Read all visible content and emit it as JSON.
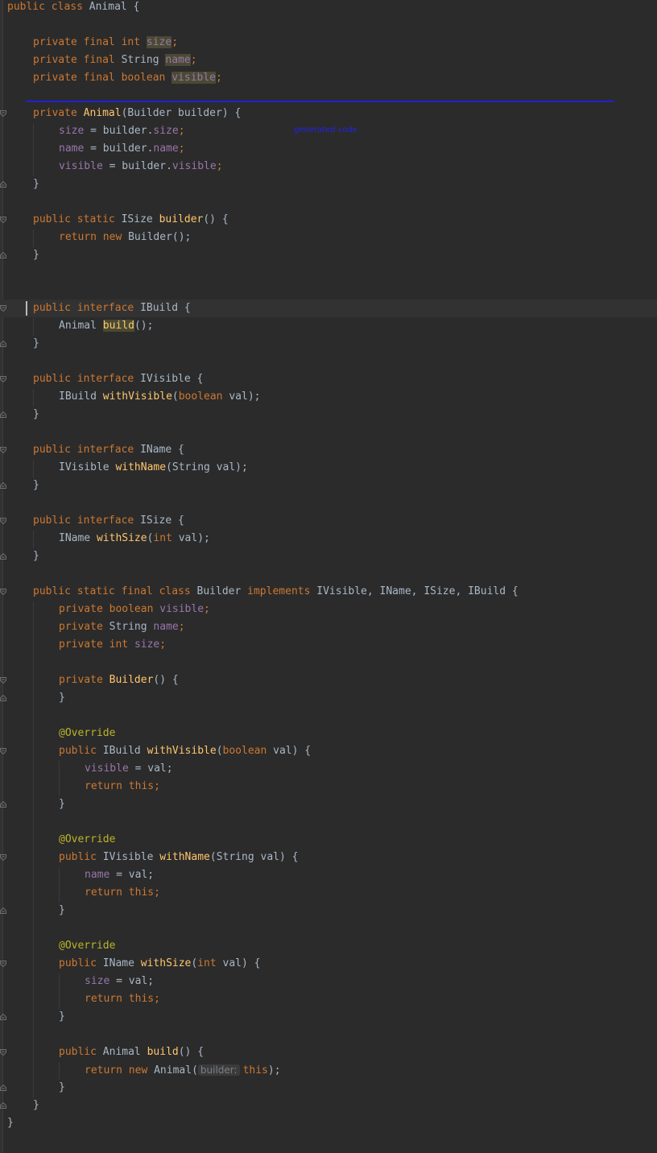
{
  "editor": {
    "generated_label": "generated code",
    "code": {
      "l1": [
        "public",
        " ",
        "class",
        " Animal {"
      ],
      "l2a": [
        "private",
        " ",
        "final",
        " ",
        "int",
        " ",
        "size",
        ";"
      ],
      "l2b": [
        "private",
        " ",
        "final",
        " String ",
        "name",
        ";"
      ],
      "l2c": [
        "private",
        " ",
        "final",
        " ",
        "boolean",
        " ",
        "visible",
        ";"
      ],
      "l3": [
        "private",
        " ",
        "Animal",
        "(Builder builder) {"
      ],
      "l4": [
        "size",
        " = builder.",
        "size",
        ";"
      ],
      "l5": [
        "name",
        " = builder.",
        "name",
        ";"
      ],
      "l6": [
        "visible",
        " = builder.",
        "visible",
        ";"
      ],
      "close": "}",
      "l7": [
        "public",
        " ",
        "static",
        " ISize ",
        "builder",
        "() {"
      ],
      "l8": [
        "return",
        " ",
        "new",
        " Builder();"
      ],
      "l9": [
        "public",
        " ",
        "interface",
        " IBuild {"
      ],
      "l10": [
        "Animal ",
        "build",
        "();"
      ],
      "l11": [
        "public",
        " ",
        "interface",
        " IVisible {"
      ],
      "l12": [
        "IBuild ",
        "withVisible",
        "(",
        "boolean",
        " val);"
      ],
      "l13": [
        "public",
        " ",
        "interface",
        " IName {"
      ],
      "l14": [
        "IVisible ",
        "withName",
        "(String val);"
      ],
      "l15": [
        "public",
        " ",
        "interface",
        " ISize {"
      ],
      "l16": [
        "IName ",
        "withSize",
        "(",
        "int",
        " val);"
      ],
      "l17": [
        "public",
        " ",
        "static",
        " ",
        "final",
        " ",
        "class",
        " Builder ",
        "implements",
        " IVisible, IName, ISize, IBuild {"
      ],
      "l18": [
        "private",
        " ",
        "boolean",
        " ",
        "visible",
        ";"
      ],
      "l19": [
        "private",
        " String ",
        "name",
        ";"
      ],
      "l20": [
        "private",
        " ",
        "int",
        " ",
        "size",
        ";"
      ],
      "l21": [
        "private",
        " ",
        "Builder",
        "() {"
      ],
      "override": "@Override",
      "l22": [
        "public",
        " IBuild ",
        "withVisible",
        "(",
        "boolean",
        " val) {"
      ],
      "l23": [
        "visible",
        " = val;"
      ],
      "l24": [
        "return",
        " ",
        "this",
        ";"
      ],
      "l25": [
        "public",
        " IVisible ",
        "withName",
        "(String val) {"
      ],
      "l26": [
        "name",
        " = val;"
      ],
      "l27": [
        "public",
        " IName ",
        "withSize",
        "(",
        "int",
        " val) {"
      ],
      "l28": [
        "size",
        " = val;"
      ],
      "l29": [
        "public",
        " Animal ",
        "build",
        "() {"
      ],
      "l30": [
        "return",
        " ",
        "new",
        " Animal(",
        "builder:",
        "this",
        ");"
      ]
    }
  }
}
